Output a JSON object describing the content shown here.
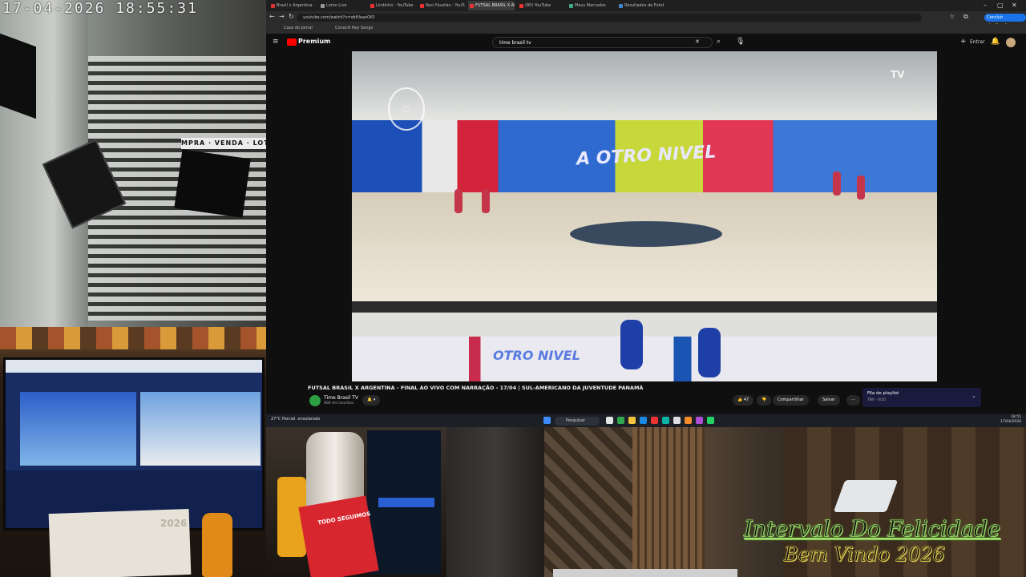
{
  "clock": "17-04-2026  18:55:31",
  "left_cam": {
    "sign_text": "MPRA · VENDA · LOT"
  },
  "desk_cam": {
    "paper_date": "2026"
  },
  "browser": {
    "tabs": [
      {
        "label": "Brasil x Argentina - Futsal",
        "active": false,
        "fav": "#d33"
      },
      {
        "label": "Lomo Live",
        "active": false,
        "fav": "#999"
      },
      {
        "label": "Lindinho - YouTube",
        "active": false,
        "fav": "#e33"
      },
      {
        "label": "Reci Faustão - YouTube",
        "active": false,
        "fav": "#e33"
      },
      {
        "label": "FUTSAL BRASIL X ARG",
        "active": true,
        "fav": "#e33"
      },
      {
        "label": "(80) YouTube",
        "active": false,
        "fav": "#e33"
      },
      {
        "label": "Meus Marcados",
        "active": false,
        "fav": "#4a8"
      },
      {
        "label": "Resultados de Futebol",
        "active": false,
        "fav": "#48c"
      }
    ],
    "window_controls": [
      "–",
      "▢",
      "✕"
    ],
    "url": "youtube.com/watch?v=xbfUaaxOIO",
    "update_label": "Concluir atualização",
    "bookmarks": [
      "Casa do Jornal",
      "Conectt Rey Songs"
    ]
  },
  "youtube": {
    "brand": "Premium",
    "search_value": "time brasil tv",
    "signin": "Entrar",
    "video_banner": "A OTRO NIVEL",
    "video_ads": "OTRO NIVEL",
    "video_brand": "TV",
    "title": "FUTSAL BRASIL X ARGENTINA - FINAL AO VIVO COM NARRAÇÃO - 17/04 | SUL-AMERICANO DA JUVENTUDE PANAMÁ",
    "channel": "Time Brasil TV",
    "subscribers": "900 mil inscritos",
    "likes": "47",
    "share": "Compartilhar",
    "save": "Salvar",
    "more": "···",
    "playlist_title": "Fila de playlist",
    "playlist_sub": "TBV · 6/10"
  },
  "taskbar": {
    "weather": "27°C Parcial. ensolarado",
    "search": "Pesquisar",
    "time": "18:55",
    "date": "17/04/2026"
  },
  "mid_cam": {
    "book_text": "TODO SEGUIMOS"
  },
  "overlay": {
    "line1": "Intervalo Do Felicidade",
    "line2": "Bem Vindo 2026"
  }
}
